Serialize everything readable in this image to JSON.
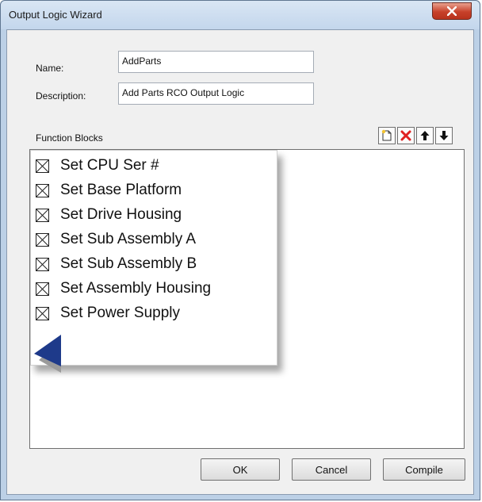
{
  "window": {
    "title": "Output Logic Wizard"
  },
  "form": {
    "name_label": "Name:",
    "name_value": "AddParts",
    "description_label": "Description:",
    "description_value": "Add Parts RCO Output Logic"
  },
  "function_blocks": {
    "label": "Function Blocks",
    "toolbar": [
      "new-block-icon",
      "delete-icon",
      "move-up-icon",
      "move-down-icon"
    ],
    "items": [
      {
        "label": "Set CPU Ser #",
        "checked": true
      },
      {
        "label": "Set Base Platform",
        "checked": true
      },
      {
        "label": "Set Drive Housing",
        "checked": true
      },
      {
        "label": "Set Sub Assembly A",
        "checked": true
      },
      {
        "label": "Set Sub Assembly B",
        "checked": true
      },
      {
        "label": "Set Assembly Housing",
        "checked": true
      },
      {
        "label": "Set Power Supply",
        "checked": true
      }
    ]
  },
  "buttons": {
    "ok": "OK",
    "cancel": "Cancel",
    "compile": "Compile"
  },
  "colors": {
    "close_button": "#c7412a",
    "delete_icon": "#e02020",
    "arrow": "#1e3a8a"
  }
}
